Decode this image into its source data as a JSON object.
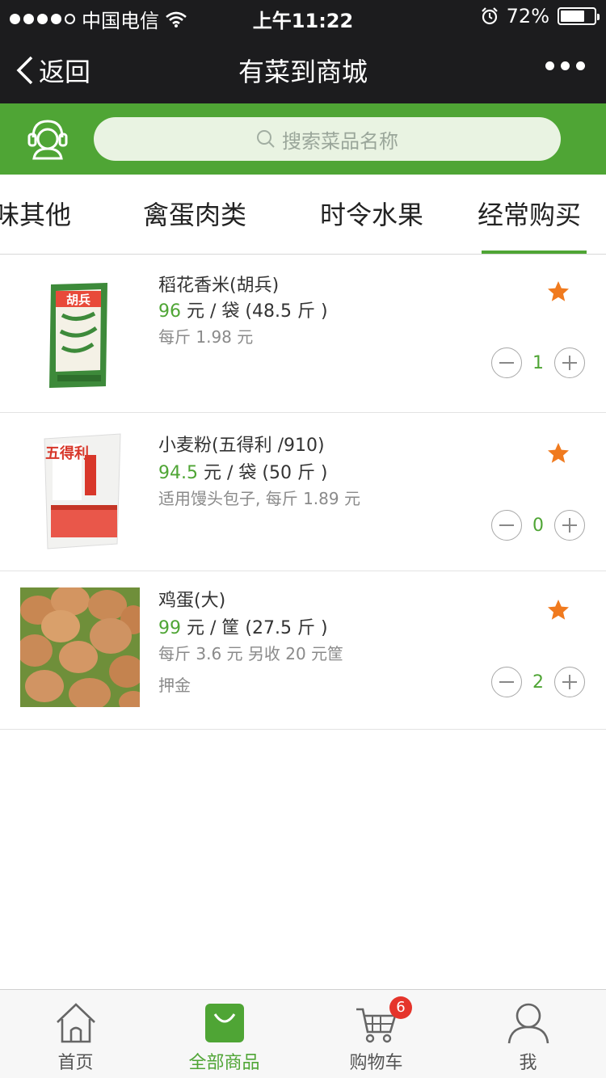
{
  "status_bar": {
    "carrier": "中国电信",
    "time": "上午11:22",
    "battery": "72%",
    "battery_level": 0.72
  },
  "nav": {
    "back_label": "返回",
    "title": "有菜到商城"
  },
  "search": {
    "placeholder": "搜索菜品名称"
  },
  "tabs": {
    "items": [
      {
        "label": "味其他"
      },
      {
        "label": "禽蛋肉类"
      },
      {
        "label": "时令水果"
      },
      {
        "label": "经常购买"
      }
    ],
    "active_index": 3
  },
  "products": [
    {
      "name": "稻花香米(胡兵)",
      "price": "96",
      "price_unit": " 元 / 袋 (48.5 斤 )",
      "note": "每斤 1.98 元",
      "note2": "",
      "quantity": "1",
      "image_caption": "胡兵"
    },
    {
      "name": "小麦粉(五得利 /910)",
      "price": "94.5",
      "price_unit": " 元 / 袋 (50 斤 )",
      "note": "适用馒头包子, 每斤 1.89 元",
      "note2": "",
      "quantity": "0",
      "image_caption": "五得利"
    },
    {
      "name": "鸡蛋(大)",
      "price": "99",
      "price_unit": " 元 / 筐 (27.5 斤 )",
      "note": "每斤 3.6 元 另收 20 元筐",
      "note2": "押金",
      "quantity": "2",
      "image_caption": ""
    }
  ],
  "tabbar": {
    "items": [
      {
        "label": "首页",
        "icon": "home-icon"
      },
      {
        "label": "全部商品",
        "icon": "shopping-bag-icon"
      },
      {
        "label": "购物车",
        "icon": "cart-icon"
      },
      {
        "label": "我",
        "icon": "user-icon"
      }
    ],
    "active_index": 1,
    "cart_badge": "6"
  },
  "colors": {
    "brand_green": "#4fa535",
    "star_orange": "#f07a1e",
    "badge_red": "#e5342b",
    "header_dark": "#1c1c1e"
  }
}
